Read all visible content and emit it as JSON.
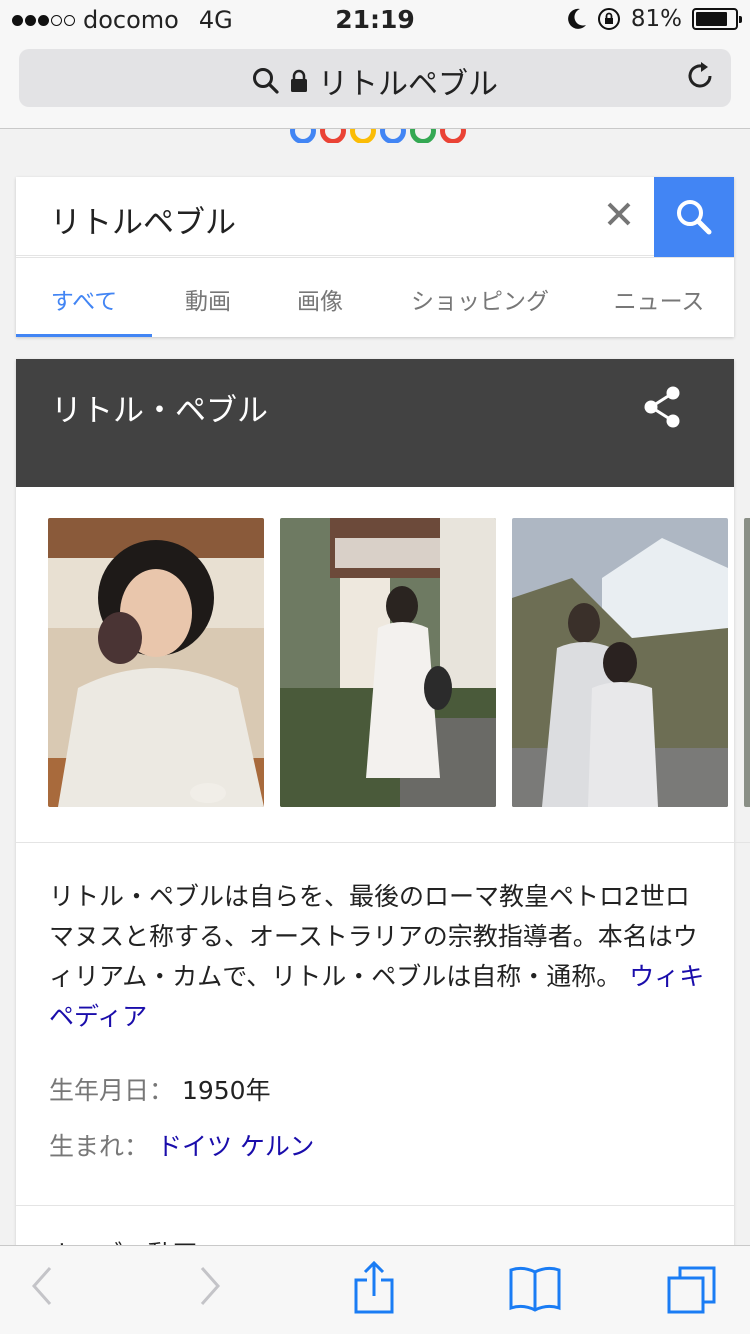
{
  "status_bar": {
    "carrier": "docomo",
    "network": "4G",
    "time": "21:19",
    "battery_percent": "81%",
    "battery_level": 0.81
  },
  "url_bar": {
    "title": "リトルペブル"
  },
  "search": {
    "query": "リトルペブル",
    "tabs": [
      {
        "label": "すべて",
        "active": true
      },
      {
        "label": "動画"
      },
      {
        "label": "画像"
      },
      {
        "label": "ショッピング"
      },
      {
        "label": "ニュース"
      }
    ]
  },
  "knowledge_panel": {
    "title": "リトル・ペブル",
    "description": "リトル・ペブルは自らを、最後のローマ教皇ペトロ2世ロマヌスと称する、オーストラリアの宗教指導者。本名はウィリアム・カムで、リトル・ペブルは自称・通称。",
    "source_link": "ウィキペディア",
    "facts": [
      {
        "key": "生年月日：",
        "value": "1950年"
      },
      {
        "key": "生まれ：",
        "value": "ドイツ ケルン"
      }
    ],
    "next_section_peek": "ホーブの動画"
  },
  "colors": {
    "accent": "#4285f4",
    "link": "#1a0dab",
    "panel_header": "#424242"
  },
  "icons": {
    "search": "search-icon",
    "lock": "lock-icon",
    "reload": "reload-icon",
    "clear": "clear-icon",
    "share": "share-icon",
    "back": "back-icon",
    "forward": "forward-icon",
    "share_sheet": "share-sheet-icon",
    "bookmarks": "bookmarks-icon",
    "tabs": "tabs-icon"
  }
}
